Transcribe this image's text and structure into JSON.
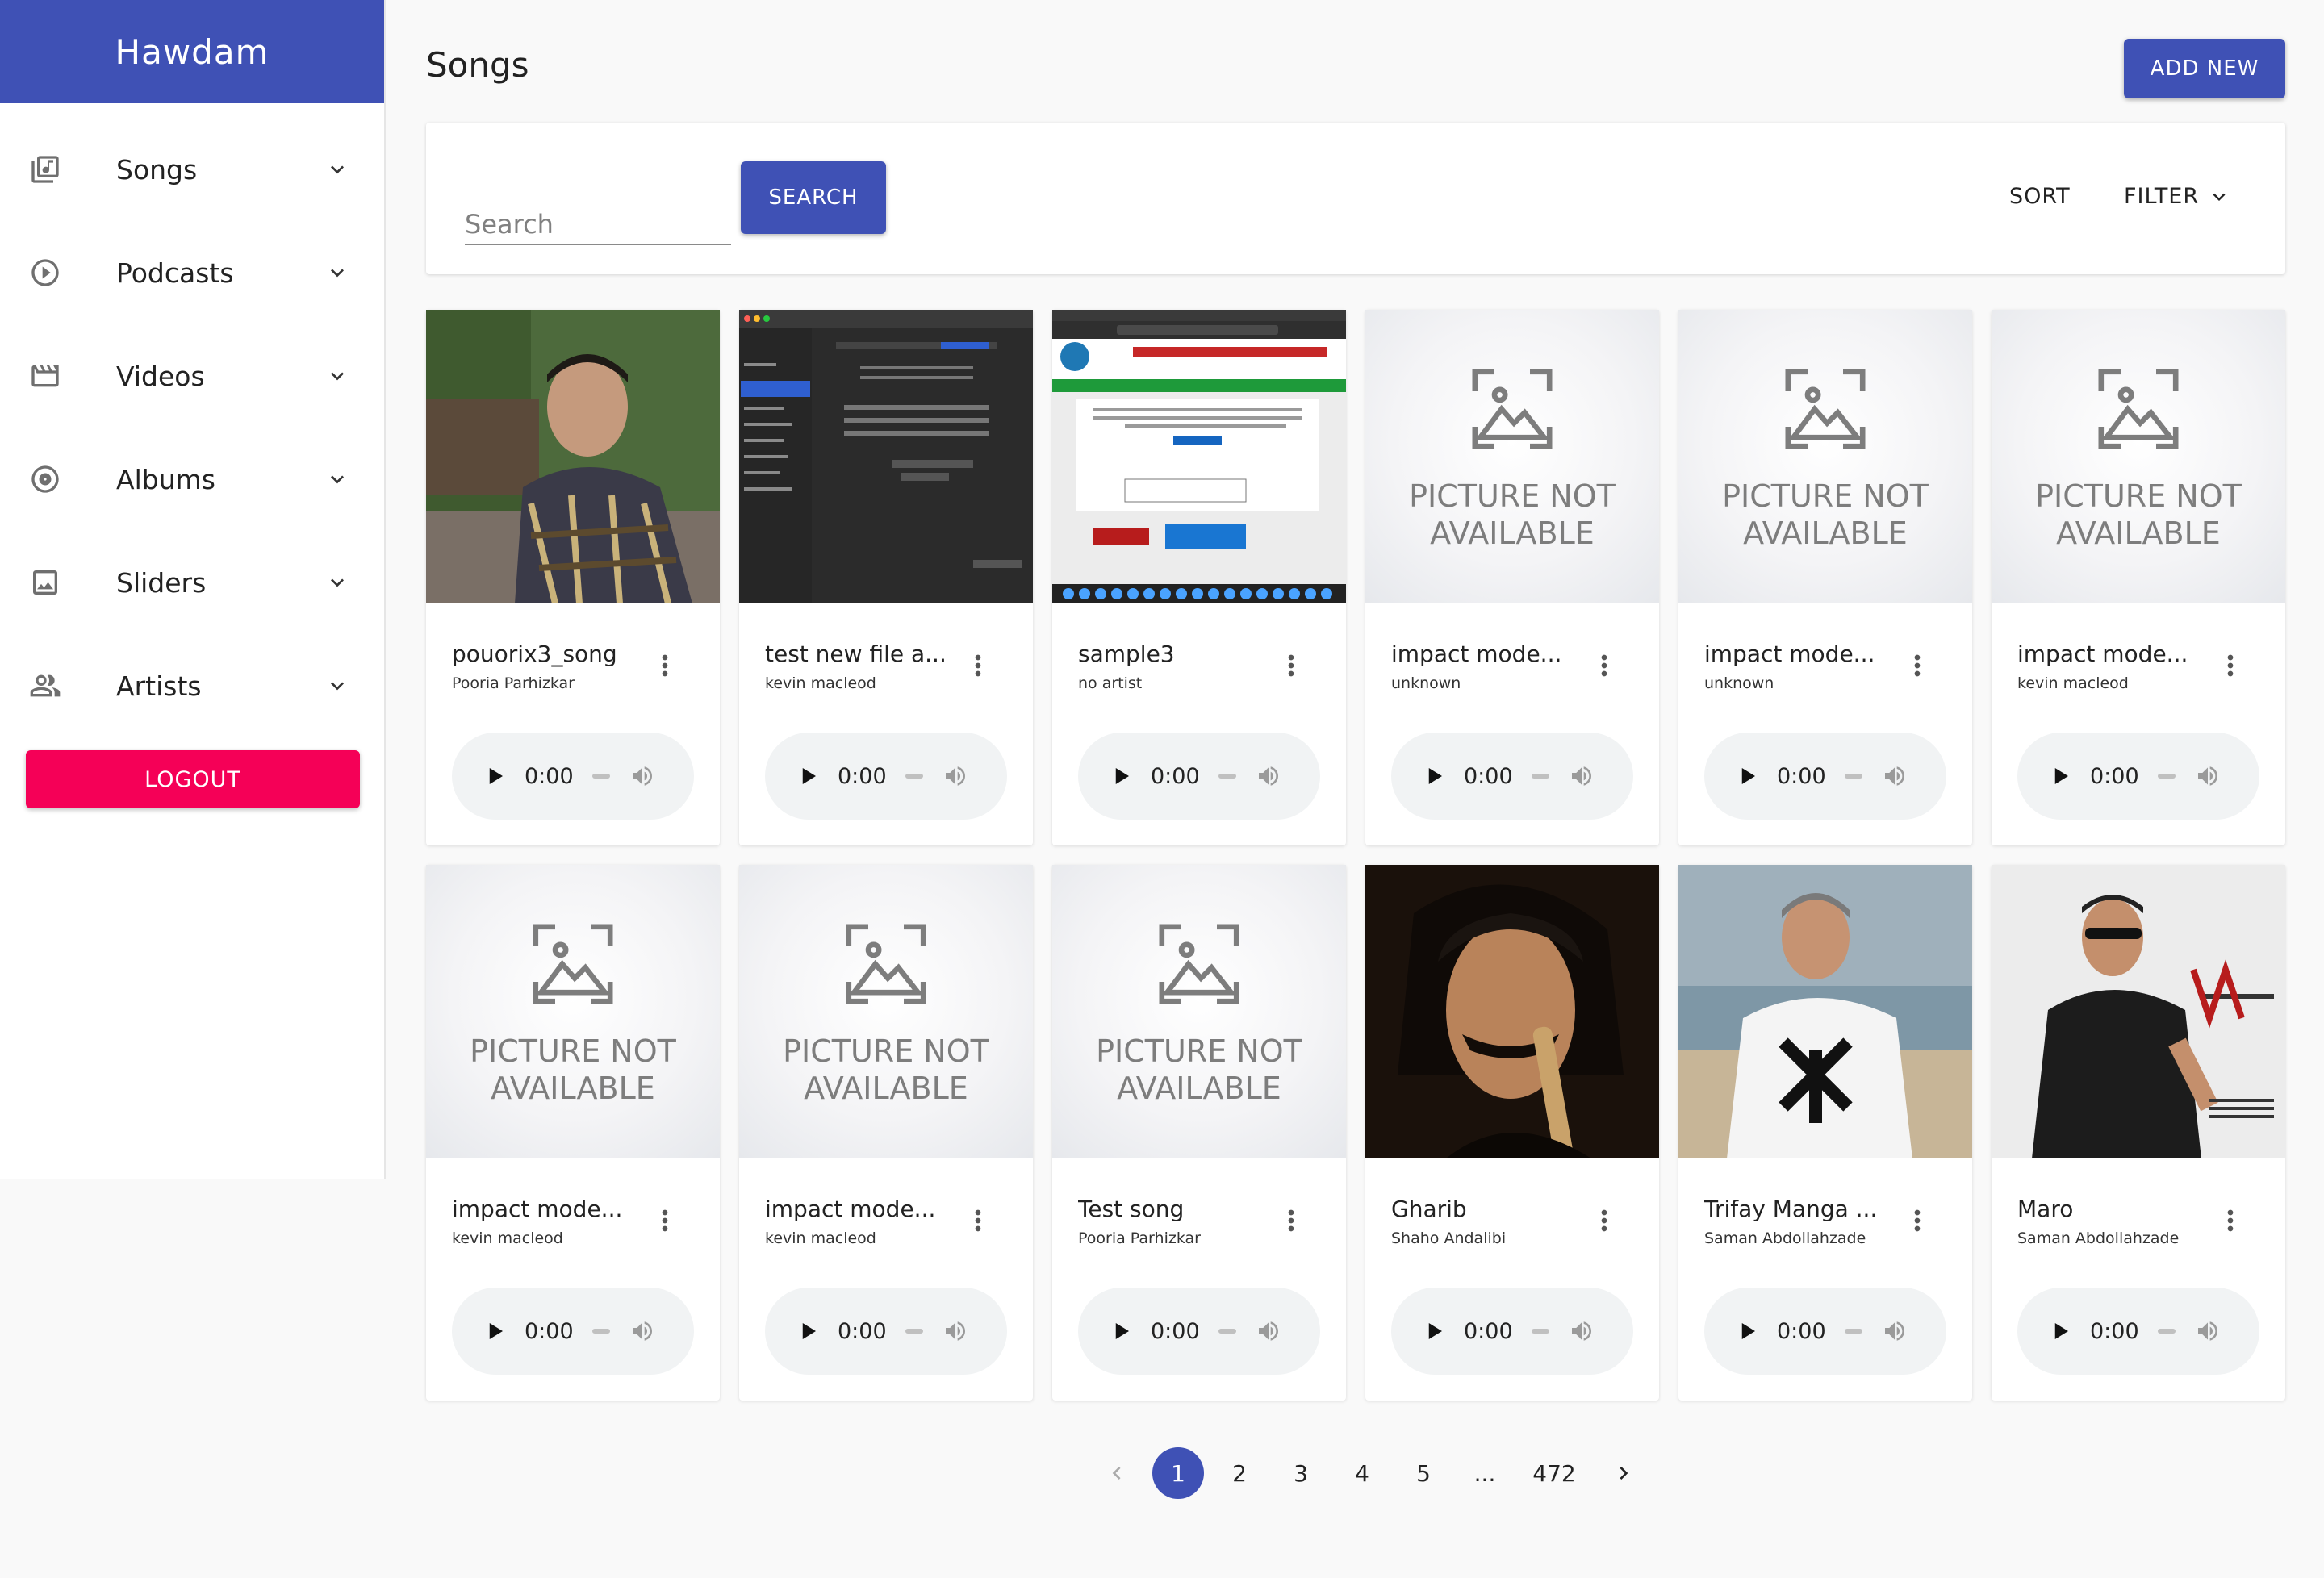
{
  "app": {
    "brand": "Hawdam"
  },
  "sidebar": {
    "items": [
      {
        "label": "Songs",
        "icon": "library-music-icon"
      },
      {
        "label": "Podcasts",
        "icon": "play-circle-icon"
      },
      {
        "label": "Videos",
        "icon": "movie-icon"
      },
      {
        "label": "Albums",
        "icon": "album-icon"
      },
      {
        "label": "Sliders",
        "icon": "image-icon"
      },
      {
        "label": "Artists",
        "icon": "people-icon"
      }
    ],
    "logout_label": "LOGOUT"
  },
  "header": {
    "title": "Songs",
    "add_label": "ADD NEW"
  },
  "toolbar": {
    "search_placeholder": "Search",
    "search_value": "",
    "search_label": "SEARCH",
    "sort_label": "SORT",
    "filter_label": "FILTER"
  },
  "placeholder_text": {
    "line1": "PICTURE NOT",
    "line2": "AVAILABLE"
  },
  "player": {
    "time": "0:00"
  },
  "songs": [
    {
      "title": "pouorix3_song",
      "artist": "Pooria Parhizkar",
      "has_image": true
    },
    {
      "title": "test new file a...",
      "artist": "kevin macleod",
      "has_image": true
    },
    {
      "title": "sample3",
      "artist": "no artist",
      "has_image": true
    },
    {
      "title": "impact mode...",
      "artist": "unknown",
      "has_image": false
    },
    {
      "title": "impact mode...",
      "artist": "unknown",
      "has_image": false
    },
    {
      "title": "impact mode...",
      "artist": "kevin macleod",
      "has_image": false
    },
    {
      "title": "impact mode...",
      "artist": "kevin macleod",
      "has_image": false
    },
    {
      "title": "impact mode...",
      "artist": "kevin macleod",
      "has_image": false
    },
    {
      "title": "Test song",
      "artist": "Pooria Parhizkar",
      "has_image": false
    },
    {
      "title": "Gharib",
      "artist": "Shaho Andalibi",
      "has_image": true
    },
    {
      "title": "Trifay Manga ...",
      "artist": "Saman Abdollahzade",
      "has_image": true
    },
    {
      "title": "Maro",
      "artist": "Saman Abdollahzade",
      "has_image": true
    }
  ],
  "pagination": {
    "pages": [
      "1",
      "2",
      "3",
      "4",
      "5",
      "...",
      "472"
    ],
    "current": "1"
  },
  "colors": {
    "primary": "#3f51b5",
    "logout": "#f50057",
    "player_bg": "#f1f3f4"
  }
}
